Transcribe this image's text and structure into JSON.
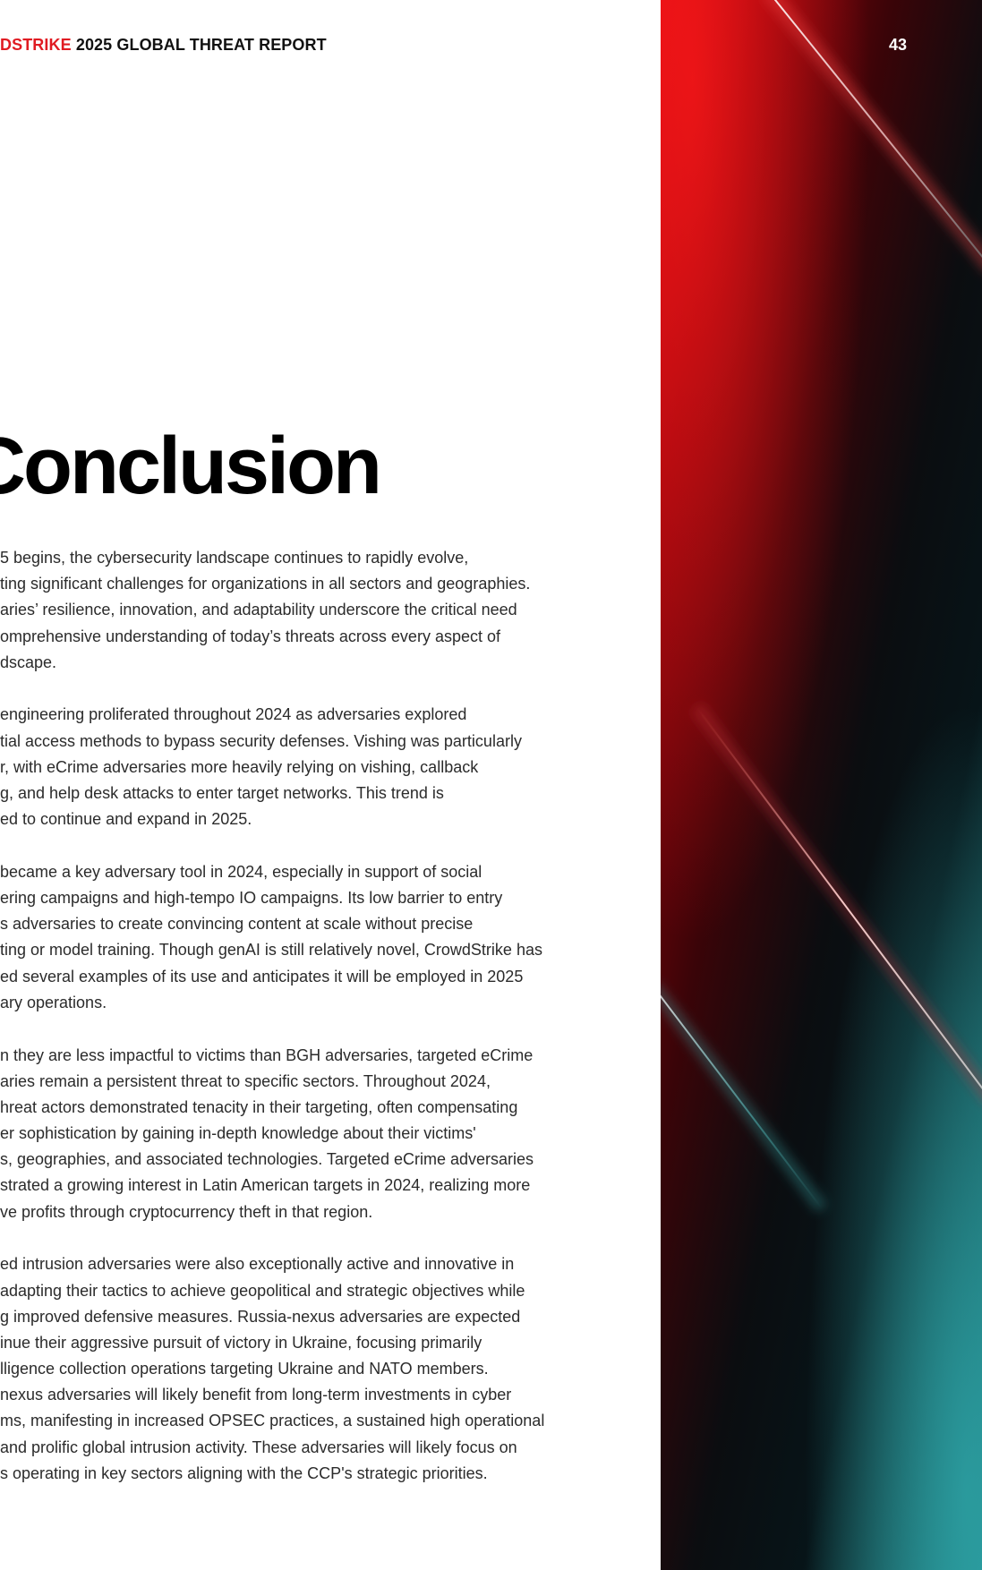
{
  "header": {
    "brand": "DSTRIKE",
    "title": "2025 GLOBAL THREAT REPORT"
  },
  "page_number": "43",
  "heading": "Conclusion",
  "paragraphs": [
    {
      "lines": [
        "5 begins, the cybersecurity landscape continues to rapidly evolve,",
        "ting significant challenges for organizations in all sectors and geographies.",
        "aries’ resilience, innovation, and adaptability underscore the critical need",
        "omprehensive understanding of today’s threats across every aspect of",
        "dscape."
      ]
    },
    {
      "lines": [
        "engineering proliferated throughout 2024 as adversaries explored",
        "tial access methods to bypass security defenses. Vishing was particularly",
        "r, with eCrime adversaries more heavily relying on vishing, callback",
        "g, and help desk attacks to enter target networks. This trend is",
        "ed to continue and expand in 2025."
      ]
    },
    {
      "lines": [
        "became a key adversary tool in 2024, especially in support of social",
        "ering campaigns and high-tempo IO campaigns. Its low barrier to entry",
        "s adversaries to create convincing content at scale without precise",
        "ting or model training. Though genAI is still relatively novel, CrowdStrike has",
        "ed several examples of its use and anticipates it will be employed in 2025",
        "ary operations."
      ]
    },
    {
      "lines": [
        "n they are less impactful to victims than BGH adversaries, targeted eCrime",
        "aries remain a persistent threat to specific sectors. Throughout 2024,",
        "hreat actors demonstrated tenacity in their targeting, often compensating",
        "er sophistication by gaining in-depth knowledge about their victims'",
        "s, geographies, and associated technologies. Targeted eCrime adversaries",
        "strated a growing interest in Latin American targets in 2024, realizing more",
        "ve profits through cryptocurrency theft in that region."
      ]
    },
    {
      "lines": [
        "ed intrusion adversaries were also exceptionally active and innovative in",
        "adapting their tactics to achieve geopolitical and strategic objectives while",
        "g improved defensive measures. Russia-nexus adversaries are expected",
        "inue their aggressive pursuit of victory in Ukraine, focusing primarily",
        "lligence collection operations targeting Ukraine and NATO members.",
        "nexus adversaries will likely benefit from long-term investments in cyber",
        "ms, manifesting in increased OPSEC practices, a sustained high operational",
        " and prolific global intrusion activity. These adversaries will likely focus on",
        "s operating in key sectors aligning with the CCP's strategic priorities."
      ]
    }
  ],
  "colors": {
    "brand_red": "#e01b22",
    "text": "#2b2b2b",
    "heading": "#000000",
    "art_red": "#d10610",
    "art_teal": "#238a8c"
  }
}
